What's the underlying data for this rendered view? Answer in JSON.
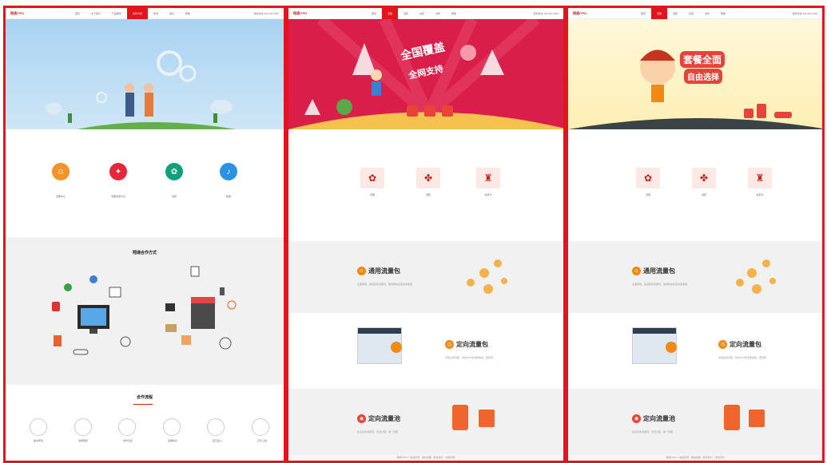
{
  "panel1": {
    "logo": "翔通ITPD",
    "nav": [
      "首页",
      "关于我们",
      "产品服务",
      "合作方式",
      "新闻",
      "联系",
      "帮助"
    ],
    "hotline": "服务热线 400-000-0000",
    "steps": [
      {
        "label": "流量中心",
        "color": "#f3932a",
        "icon": "☺"
      },
      {
        "label": "流量充值平台",
        "color": "#e5263b",
        "icon": "✦"
      },
      {
        "label": "话费",
        "color": "#10a17a",
        "icon": "✿"
      },
      {
        "label": "其他",
        "color": "#2a92e5",
        "icon": "♪"
      }
    ],
    "mid_title": "翔通合作方式",
    "flow_title": "合作流程",
    "flow_steps": [
      "提交申请",
      "资质审核",
      "合作洽谈",
      "签署协议",
      "接口接入",
      "正式上线"
    ]
  },
  "panel2": {
    "logo": "翔通ITPD",
    "nav": [
      "首页",
      "流量",
      "话费",
      "充值",
      "合作",
      "帮助"
    ],
    "hotline": "服务热线 400-000-0000",
    "banner_line1": "全国覆盖",
    "banner_line2": "全网支持",
    "cards": [
      "流量",
      "话费",
      "充值卡"
    ],
    "pkg1": {
      "title": "通用流量包",
      "desc": "全国通用，各运营商流量包，随时随地任意充值使用"
    },
    "pkg2": {
      "title": "定向流量包",
      "desc": "定向应用流量，特定APP免流量使用，更划算"
    },
    "pkg3": {
      "title": "定向流量池",
      "desc": "企业定向流量池，灵活分配，统一管理"
    },
    "footer": "翔通ITPD © 版权所有 · 网站地图 · 联系我们 · 法律声明"
  },
  "panel3": {
    "logo": "翔通ITPD",
    "nav": [
      "首页",
      "流量",
      "话费",
      "充值",
      "合作",
      "帮助"
    ],
    "hotline": "服务热线 400-000-0000",
    "banner_line1": "套餐全面",
    "banner_line2": "自由选择",
    "cards": [
      "流量",
      "话费",
      "充值卡"
    ],
    "pkg1": {
      "title": "通用流量包",
      "desc": "全国通用，各运营商流量包，随时随地任意充值使用"
    },
    "pkg2": {
      "title": "定向流量包",
      "desc": "定向应用流量，特定APP免流量使用，更划算"
    },
    "pkg3": {
      "title": "定向流量池",
      "desc": "企业定向流量池，灵活分配，统一管理"
    },
    "footer": "翔通ITPD © 版权所有 · 网站地图 · 联系我们 · 法律声明"
  }
}
